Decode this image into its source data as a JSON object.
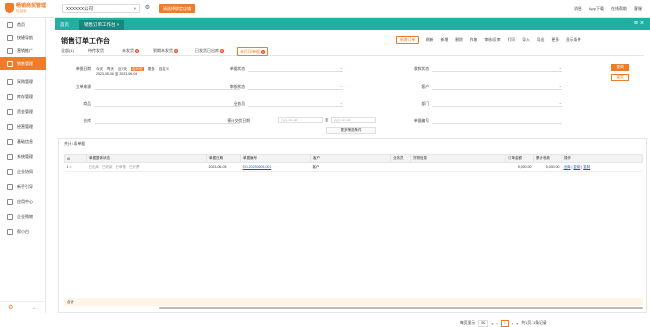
{
  "app": {
    "logo_title": "畅销商贸管理",
    "logo_sub": "轻量版",
    "company": "XXXXXX公司",
    "bind_btn": "请选择绑定店铺"
  },
  "topright": [
    "消息",
    "App下载",
    "在线帮助",
    "客服"
  ],
  "sidebar": [
    "首页",
    "快捷导航",
    "营销推广",
    "销售管理",
    "采购管理",
    "库存管理",
    "资金管理",
    "经营管理",
    "基础信息",
    "系统管理",
    "企业协同",
    "新手引导",
    "应用中心",
    "企业购物",
    "帮小白"
  ],
  "tabs": [
    "首页",
    "销售订单工作台"
  ],
  "page": {
    "title": "销售订单工作台",
    "new_btn": "新增订单"
  },
  "toolbar": [
    "刷新",
    "新增",
    "删除",
    "作废",
    "审核/反审",
    "打印",
    "导入",
    "导出",
    "更多",
    "显示条件"
  ],
  "subtabs": [
    {
      "label": "全部(1)",
      "badge": ""
    },
    {
      "label": "待传发货",
      "badge": ""
    },
    {
      "label": "未发货",
      "badge": "0"
    },
    {
      "label": "到期未发货",
      "badge": "0"
    },
    {
      "label": "已发货已出库",
      "badge": "0"
    },
    {
      "label": "未打印单据",
      "badge": "1"
    }
  ],
  "filters": {
    "date_label": "单据日期",
    "date_opts": [
      "今天",
      "昨天",
      "近7天",
      "近30天",
      "更多",
      "自定义"
    ],
    "date_selected": "近30天",
    "date_range": "2023-05-06 至 2023-06-04",
    "doc_status": "单据状态",
    "receipt_status": "收款状态",
    "source": "立单来源",
    "audit_status": "审核状态",
    "customer": "客户",
    "product": "商品",
    "salesman": "业务员",
    "dept": "部门",
    "warehouse": "仓库",
    "delivery_date": "预计交货日期",
    "date_ph": "yyyy-mm-dd",
    "to": "至",
    "doc_no": "单据编号",
    "search": "查询",
    "reset": "重置",
    "more": "更多筛选条件"
  },
  "grid": {
    "title": "共计",
    "count": "1",
    "title_tail": "条单据",
    "headers": [
      "",
      "单据整体状态",
      "单据日期",
      "单据编号",
      "客户",
      "业务员",
      "货物信息",
      "订单金额",
      "累计收款",
      "操作"
    ],
    "rows": [
      {
        "idx": "1",
        "status": [
          "已出库",
          "已收款",
          "已审核",
          "已开票"
        ],
        "date": "2023-06-05",
        "no": "SO-20230605-001",
        "customer": "客户",
        "goods": "",
        "amount": "5,000.00",
        "received": "5,000.00",
        "ops": [
          "出库",
          "复制",
          "复制"
        ]
      }
    ],
    "sum_label": "合计"
  },
  "pager": {
    "per_page": "每页显示",
    "size": "50",
    "page": "1",
    "total": "共1页, 1条记录"
  }
}
